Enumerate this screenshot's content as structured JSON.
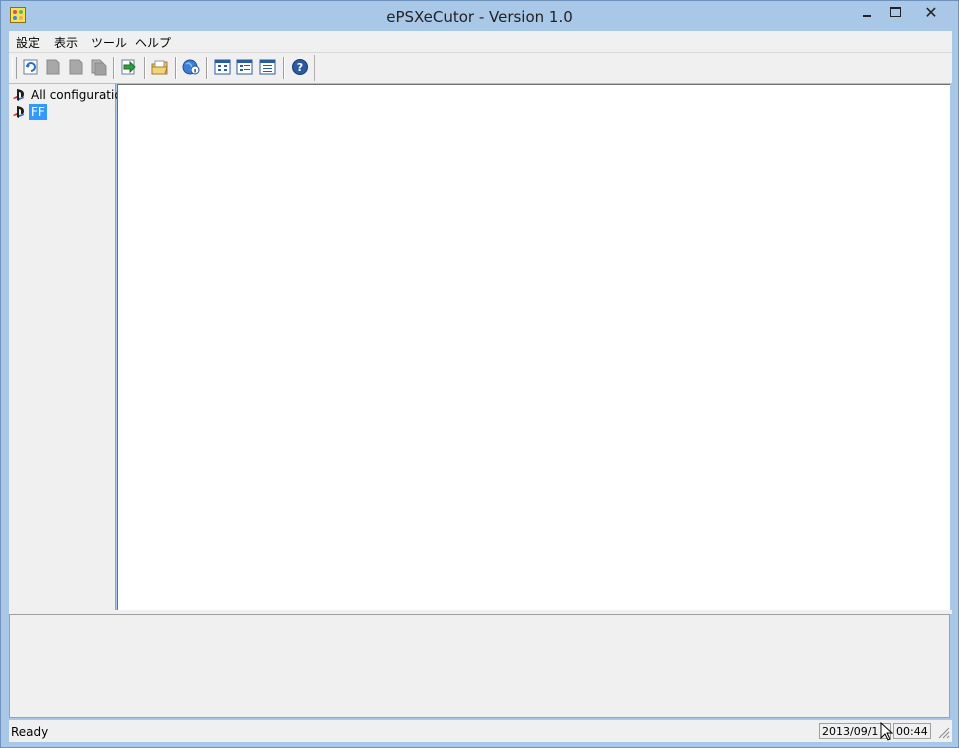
{
  "window": {
    "title": "ePSXeCutor - Version 1.0",
    "controls": {
      "minimize": "minimize-icon",
      "maximize": "maximize-icon",
      "close": "✕"
    }
  },
  "menubar": {
    "items": [
      {
        "label": "設定"
      },
      {
        "label": "表示"
      },
      {
        "label": "ツール"
      },
      {
        "label": "ヘルプ"
      }
    ]
  },
  "toolbar": {
    "buttons": [
      {
        "icon": "refresh-icon",
        "enabled": true
      },
      {
        "icon": "document-icon",
        "enabled": false
      },
      {
        "icon": "document-icon",
        "enabled": false
      },
      {
        "icon": "document-copy-icon",
        "enabled": false
      },
      {
        "icon": "exit-arrow-icon",
        "enabled": true
      },
      {
        "icon": "folder-open-icon",
        "enabled": true
      },
      {
        "icon": "globe-info-icon",
        "enabled": true
      },
      {
        "icon": "large-icons-view-icon",
        "enabled": true,
        "pressed": true
      },
      {
        "icon": "small-icons-view-icon",
        "enabled": true
      },
      {
        "icon": "list-view-icon",
        "enabled": true
      },
      {
        "icon": "help-icon",
        "enabled": true
      }
    ]
  },
  "tree": {
    "items": [
      {
        "label": "All configuration",
        "selected": false,
        "icon": "playstation-icon"
      },
      {
        "label": "FF",
        "selected": true,
        "icon": "playstation-icon"
      }
    ]
  },
  "statusbar": {
    "text": "Ready",
    "date": "2013/09/1",
    "time": "00:44"
  },
  "colors": {
    "frame": "#a9c7e6",
    "selection": "#3399ff",
    "panel": "#f0f0f0"
  }
}
